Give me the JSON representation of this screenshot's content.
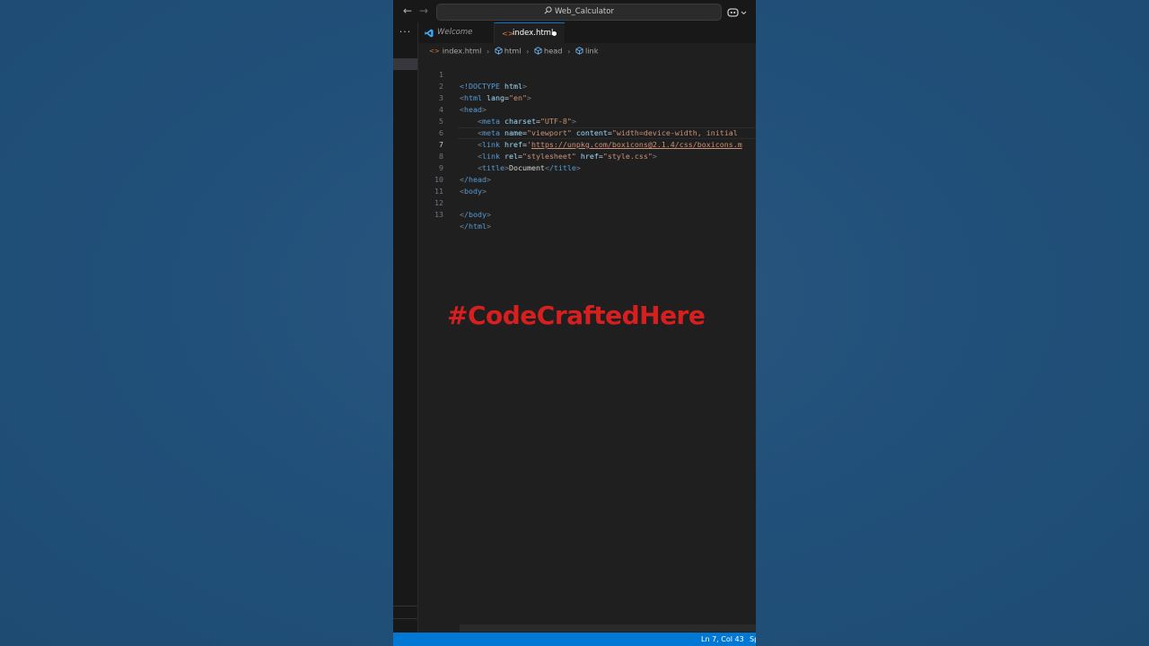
{
  "titlebar": {
    "search_text": "Web_Calculator",
    "icons": [
      "arrow-left-icon",
      "arrow-right-icon",
      "search-icon",
      "copilot-icon",
      "chevron-down-icon"
    ]
  },
  "activitybar": {
    "more_label": "···"
  },
  "tabs": [
    {
      "label": "Welcome",
      "icon": "vscode-icon",
      "active": false
    },
    {
      "label": "index.html",
      "icon": "html-icon",
      "active": true,
      "modified": true
    }
  ],
  "breadcrumb": [
    "index.html",
    "html",
    "head",
    "link"
  ],
  "editor": {
    "current_line": 7,
    "lines": [
      {
        "n": "1"
      },
      {
        "n": "2"
      },
      {
        "n": "3"
      },
      {
        "n": "4"
      },
      {
        "n": "5"
      },
      {
        "n": "6"
      },
      {
        "n": "7"
      },
      {
        "n": "8"
      },
      {
        "n": "9"
      },
      {
        "n": "10"
      },
      {
        "n": "11"
      },
      {
        "n": "12"
      },
      {
        "n": "13"
      }
    ],
    "code": {
      "l1_doctype": "<!DOCTYPE",
      "l1_html": "html",
      "l2_tag": "html",
      "l2_attr": "lang",
      "l2_val": "\"en\"",
      "l3_tag": "head",
      "l4_tag": "meta",
      "l4_attr": "charset",
      "l4_val": "\"UTF-8\"",
      "l5_tag": "meta",
      "l5_attr1": "name",
      "l5_val1": "\"viewport\"",
      "l5_attr2": "content",
      "l5_val2": "\"width=device-width, initial",
      "l6_tag": "link",
      "l6_attr": "href",
      "l6_val_q": "'",
      "l6_url": "https://unpkg.com/boxicons@2.1.4/css/boxicons.m",
      "l7_tag": "link",
      "l7_attr1": "rel",
      "l7_val1": "\"stylesheet\"",
      "l7_attr2": "href",
      "l7_val2": "\"style.css\"",
      "l8_tag": "title",
      "l8_text": "Document",
      "l8_close": "/title",
      "l9_tag": "/head",
      "l10_tag": "body",
      "l12_tag": "/body",
      "l13_tag": "/html"
    }
  },
  "statusbar": {
    "position": "Ln 7, Col 43",
    "spaces": "Sp"
  },
  "watermark": "#CodeCraftedHere",
  "colors": {
    "accent": "#0078d4",
    "background": "#21507a",
    "watermark": "#d81f1f"
  }
}
